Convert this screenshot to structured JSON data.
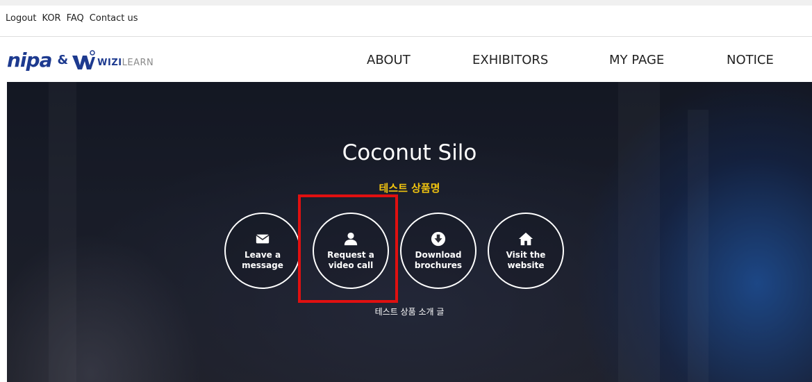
{
  "util_links": [
    "Logout",
    "KOR",
    "FAQ",
    "Contact us"
  ],
  "logo": {
    "brand1": "nipa",
    "amp": "&",
    "brand2_a": "WIZI",
    "brand2_b": "LEARN"
  },
  "nav": [
    "ABOUT",
    "EXHIBITORS",
    "MY PAGE",
    "NOTICE"
  ],
  "hero": {
    "title": "Coconut Silo",
    "subtitle": "테스트 상품명",
    "actions": [
      {
        "icon": "envelope-icon",
        "label1": "Leave a",
        "label2": "message"
      },
      {
        "icon": "user-icon",
        "label1": "Request a",
        "label2": "video call"
      },
      {
        "icon": "download-circle-icon",
        "label1": "Download",
        "label2": "brochures"
      },
      {
        "icon": "home-icon",
        "label1": "Visit the",
        "label2": "website"
      }
    ],
    "description": "테스트 상품 소개 글"
  },
  "colors": {
    "brand": "#1d3a8f",
    "subtitle": "#f1c40f",
    "highlight": "#e01010"
  }
}
